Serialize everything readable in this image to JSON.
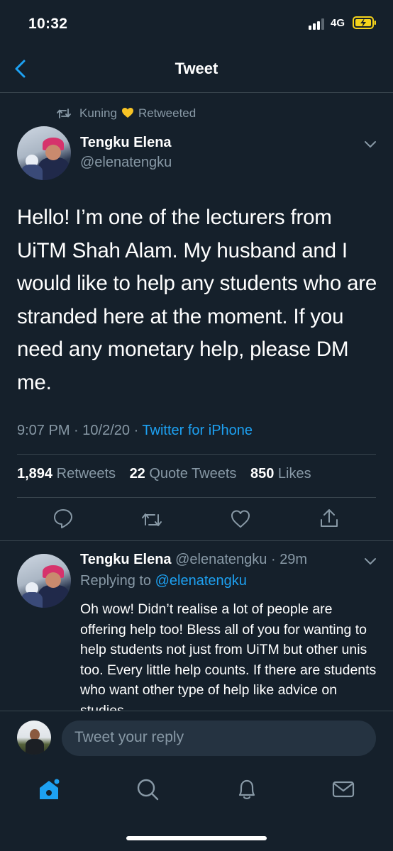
{
  "status_bar": {
    "time": "10:32",
    "network": "4G"
  },
  "header": {
    "title": "Tweet"
  },
  "retweet_context": {
    "name": "Kuning",
    "label": "Retweeted"
  },
  "tweet": {
    "author_name": "Tengku Elena",
    "author_handle": "@elenatengku",
    "text": "Hello! I’m one of the lecturers from UiTM Shah Alam. My husband and I would like to help any students who are stranded here at the moment. If you need any monetary help, please DM me.",
    "time": "9:07 PM",
    "date": "10/2/20",
    "source": "Twitter for iPhone",
    "stats": {
      "retweets_count": "1,894",
      "retweets_label": "Retweets",
      "quote_count": "22",
      "quote_label": "Quote Tweets",
      "likes_count": "850",
      "likes_label": "Likes"
    }
  },
  "reply": {
    "author_name": "Tengku Elena",
    "author_handle": "@elenatengku",
    "age": "29m",
    "replying_label": "Replying to",
    "replying_handle": "@elenatengku",
    "text": "Oh wow! Didn’t realise a lot of people are offering help too! Bless all of you for wanting to help students not just from UiTM but other unis too. Every little help counts. If there are students who want other type of help like advice on studies"
  },
  "composer": {
    "placeholder": "Tweet your reply"
  },
  "colors": {
    "background": "#15202b",
    "accent": "#1da1f2",
    "muted": "#8899a6",
    "divider": "#38444d",
    "battery": "#f5d31b"
  },
  "icons": {
    "back": "chevron-left-icon",
    "retweet_context": "retweet-icon",
    "more": "chevron-down-icon",
    "reply": "comment-icon",
    "retweet": "retweet-icon",
    "like": "heart-icon",
    "share": "share-icon",
    "tabs": [
      "home-icon",
      "search-icon",
      "bell-icon",
      "mail-icon"
    ]
  }
}
